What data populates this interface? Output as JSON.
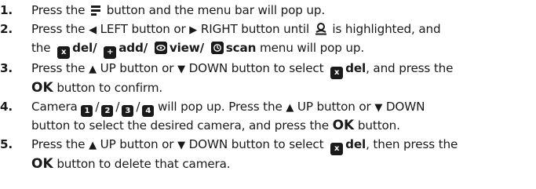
{
  "steps": [
    {
      "num": "1.",
      "t1": "Press the",
      "t2": "button and the menu bar will pop up."
    },
    {
      "num": "2.",
      "left_arrow": "◀",
      "t1": "Press the",
      "left": "LEFT button or",
      "right_arrow": "▶",
      "right": "RIGHT button until",
      "t2": "is highlighted, and",
      "the": "the",
      "del": "del/",
      "add": "add/",
      "view": "view/",
      "scan": "scan",
      "tail": "menu will pop up."
    },
    {
      "num": "3.",
      "t1": "Press the",
      "up_arrow": "▲",
      "up": "UP button or",
      "down_arrow": "▼",
      "down": "DOWN button to select",
      "del": "del",
      "t2": ", and press the",
      "ok": "OK",
      "t3": "button to confirm."
    },
    {
      "num": "4.",
      "t1": "Camera",
      "cams": [
        "1",
        "2",
        "3",
        "4"
      ],
      "t2": "will pop up. Press the",
      "up_arrow": "▲",
      "up": "UP button or",
      "down_arrow": "▼",
      "down": "DOWN",
      "t3": "button to select the desired camera, and press the",
      "ok": "OK",
      "t4": "button."
    },
    {
      "num": "5.",
      "t1": "Press the",
      "up_arrow": "▲",
      "up": "UP button or",
      "down_arrow": "▼",
      "down": "DOWN button to select",
      "del": "del",
      "t2": ", then press the",
      "ok": "OK",
      "t3": "button to delete that camera."
    }
  ],
  "icons": {
    "menu": "menu-icon",
    "person": "person-icon",
    "del": "x",
    "add": "+",
    "view": "eye-icon",
    "scan": "scan-icon"
  }
}
